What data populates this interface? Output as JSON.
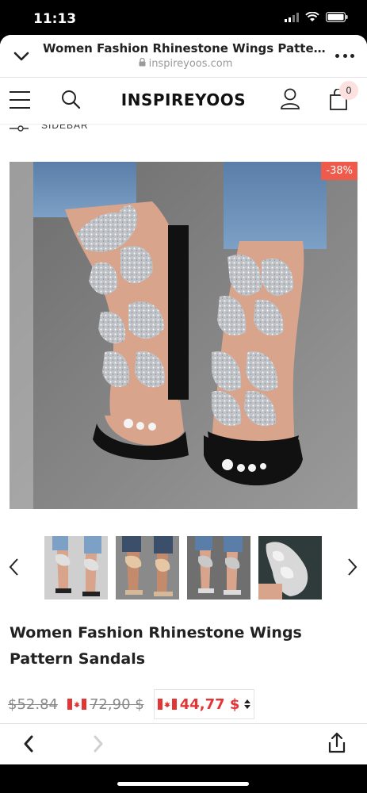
{
  "status_bar": {
    "time": "11:13"
  },
  "browser": {
    "page_title": "Women Fashion Rhinestone Wings Pattern San...",
    "domain": "inspireyoos.com"
  },
  "site": {
    "logo_text": "INSPIREYOOS",
    "cart_count": "0",
    "sidebar_label": "SIDEBAR"
  },
  "product": {
    "discount_badge": "-38%",
    "title": "Women Fashion Rhinestone Wings Pattern Sandals",
    "old_price": "$52.84",
    "old_price_cad": "72,90 $",
    "price_cad": "44,77 $"
  },
  "icons": {
    "menu": "hamburger-icon",
    "search": "search-icon",
    "account": "user-icon",
    "cart": "shopping-bag-icon",
    "share": "share-icon"
  },
  "colors": {
    "sale_badge": "#ef5a4a",
    "price": "#e23636",
    "cart_badge_bg": "#fde0e0"
  }
}
